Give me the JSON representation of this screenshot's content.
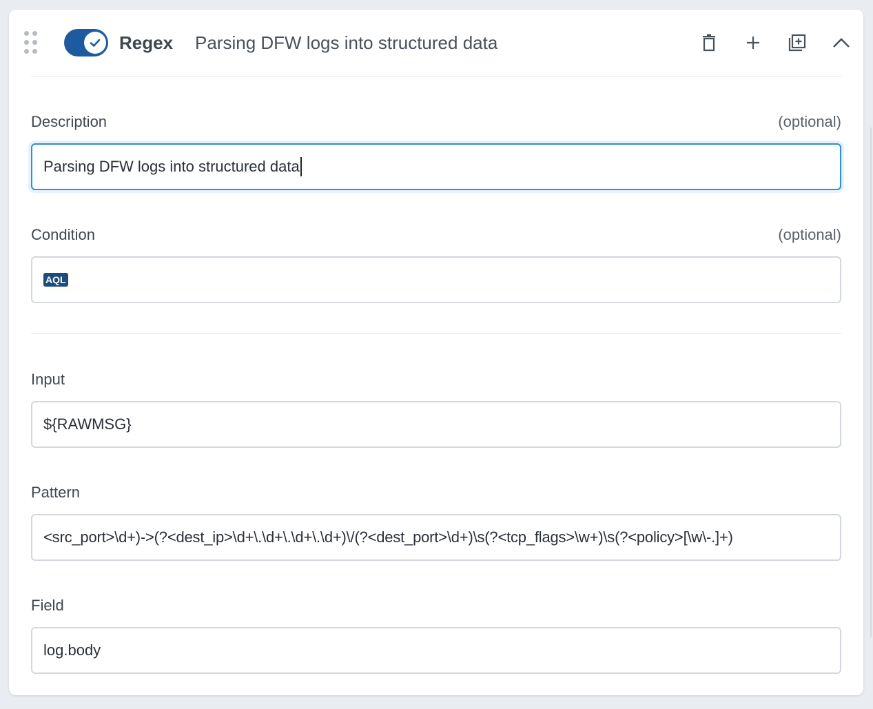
{
  "header": {
    "enabled": true,
    "processor_type": "Regex",
    "description_title": "Parsing DFW logs into structured data",
    "icons": [
      "drag-handle-icon",
      "check-icon",
      "trash-icon",
      "plus-icon",
      "duplicate-icon",
      "chevron-up-icon"
    ]
  },
  "description": {
    "label": "Description",
    "optional_label": "(optional)",
    "value": "Parsing DFW logs into structured data"
  },
  "condition": {
    "label": "Condition",
    "optional_label": "(optional)",
    "badge": "AQL",
    "value": ""
  },
  "input": {
    "label": "Input",
    "value": "${RAWMSG}"
  },
  "pattern": {
    "label": "Pattern",
    "value": "<src_port>\\d+)->(?<dest_ip>\\d+\\.\\d+\\.\\d+\\.\\d+)\\/(?<dest_port>\\d+)\\s(?<tcp_flags>\\w+)\\s(?<policy>[\\w\\-.]+)"
  },
  "field": {
    "label": "Field",
    "value": "log.body"
  },
  "colors": {
    "toggle": "#1e5a9f",
    "focus": "#2e8fd6",
    "aql_badge": "#1e4b7d"
  }
}
